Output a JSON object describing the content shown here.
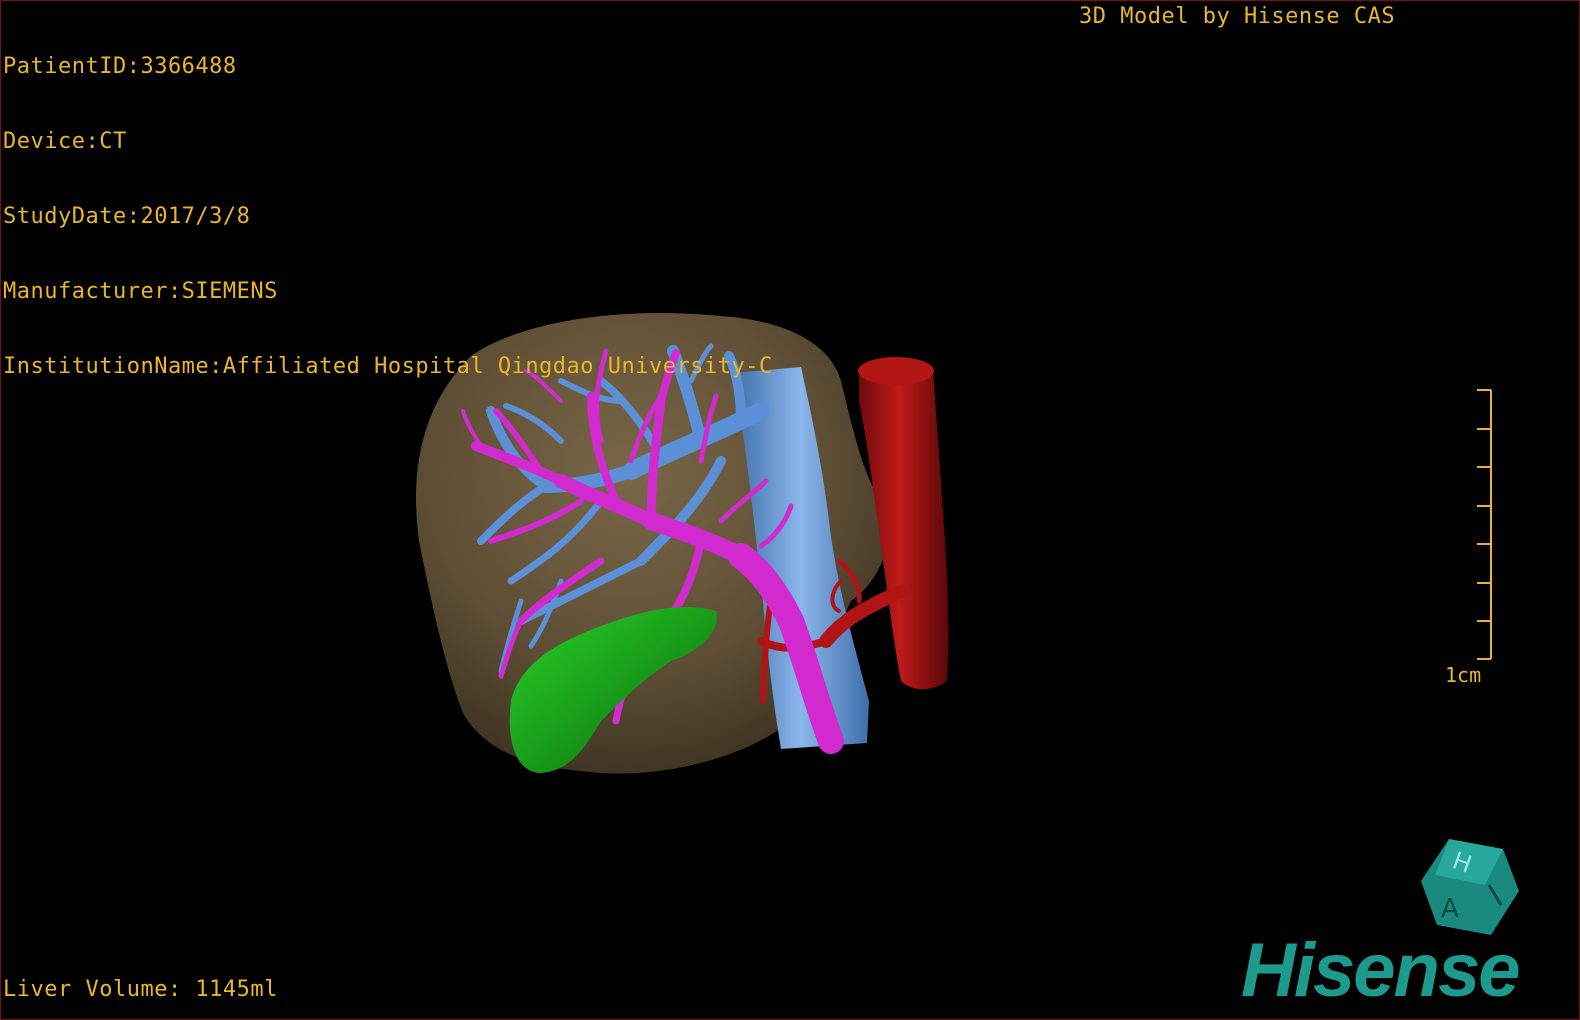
{
  "patient_info": {
    "patient_id": "PatientID:3366488",
    "device": "Device:CT",
    "study_date": "StudyDate:2017/3/8",
    "manufacturer": "Manufacturer:SIEMENS",
    "institution": "InstitutionName:Affiliated Hospital Qingdao University-C"
  },
  "credit": "3D Model by Hisense CAS",
  "liver_volume": "Liver Volume: 1145ml",
  "scale_bar": {
    "label": "1cm",
    "ticks": 8
  },
  "orientation_cube": {
    "letters": [
      "H",
      "A"
    ]
  },
  "logo": "Hisense",
  "colors": {
    "overlay_text": "#e8b628",
    "liver": "#6b5a3f",
    "portal_vein": "#d12bd0",
    "hepatic_vein": "#5b8fd6",
    "artery": "#a81414",
    "gallbladder": "#1aa81a",
    "brand": "#1c9a8d",
    "border": "#7a1010"
  }
}
